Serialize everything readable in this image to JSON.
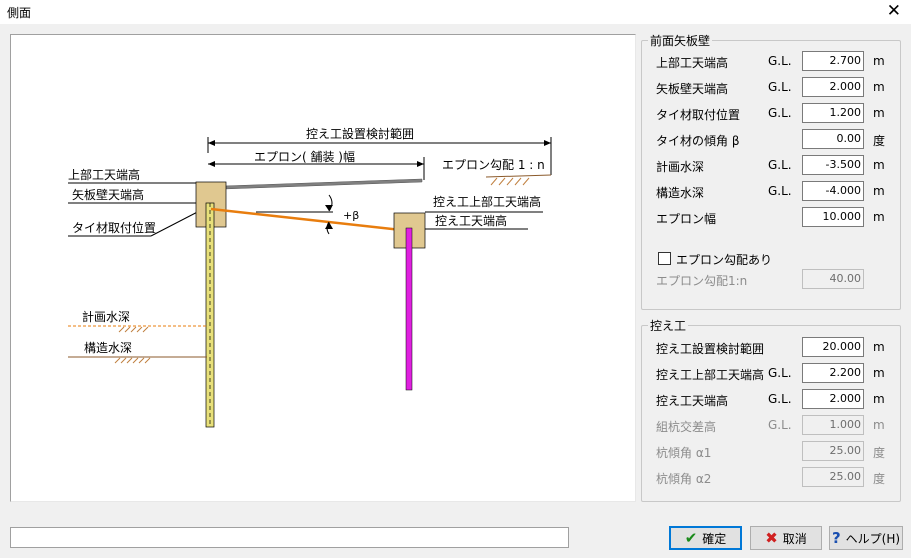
{
  "window": {
    "title": "側面",
    "close": "✕"
  },
  "diagram": {
    "range_label": "控え工設置検討範囲",
    "apron_width_label": "エプロン( 舗装 )幅",
    "apron_slope_label": "エプロン勾配 1 : n",
    "top_label": "上部工天端高",
    "sheet_top_label": "矢板壁天端高",
    "tie_label": "タイ材取付位置",
    "beta_label": "+β",
    "anchor_top_label": "控え工上部工天端高",
    "anchor_crest_label": "控え工天端高",
    "design_water_label": "計画水深",
    "structure_water_label": "構造水深",
    "colors": {
      "sheet_pile": "#e8e07a",
      "concrete": "#e0c890",
      "tie_rod": "#e87d0e",
      "anchor_pile": "#e020e0",
      "apron": "#808080",
      "water": "#e87d0e"
    }
  },
  "front": {
    "legend": "前面矢板壁",
    "rows": [
      {
        "label": "上部工天端高",
        "gl": "G.L.",
        "value": "2.700",
        "unit": "m"
      },
      {
        "label": "矢板壁天端高",
        "gl": "G.L.",
        "value": "2.000",
        "unit": "m"
      },
      {
        "label": "タイ材取付位置",
        "gl": "G.L.",
        "value": "1.200",
        "unit": "m"
      },
      {
        "label": "タイ材の傾角 β",
        "gl": "",
        "value": "0.00",
        "unit": "度"
      },
      {
        "label": "計画水深",
        "gl": "G.L.",
        "value": "-3.500",
        "unit": "m"
      },
      {
        "label": "構造水深",
        "gl": "G.L.",
        "value": "-4.000",
        "unit": "m"
      },
      {
        "label": "エプロン幅",
        "gl": "",
        "value": "10.000",
        "unit": "m"
      }
    ],
    "apron_checkbox": "エプロン勾配あり",
    "apron_slope": {
      "label": "エプロン勾配1:n",
      "value": "40.00"
    }
  },
  "anchor": {
    "legend": "控え工",
    "rows": [
      {
        "label": "控え工設置検討範囲",
        "gl": "",
        "value": "20.000",
        "unit": "m"
      },
      {
        "label": "控え工上部工天端高",
        "gl": "G.L.",
        "value": "2.200",
        "unit": "m"
      },
      {
        "label": "控え工天端高",
        "gl": "G.L.",
        "value": "2.000",
        "unit": "m"
      },
      {
        "label": "組杭交差高",
        "gl": "G.L.",
        "value": "1.000",
        "unit": "m"
      },
      {
        "label": "杭傾角 α1",
        "gl": "",
        "value": "25.00",
        "unit": "度"
      },
      {
        "label": "杭傾角 α2",
        "gl": "",
        "value": "25.00",
        "unit": "度"
      }
    ]
  },
  "buttons": {
    "ok": "確定",
    "cancel": "取消",
    "help": "ヘルプ(H)"
  }
}
